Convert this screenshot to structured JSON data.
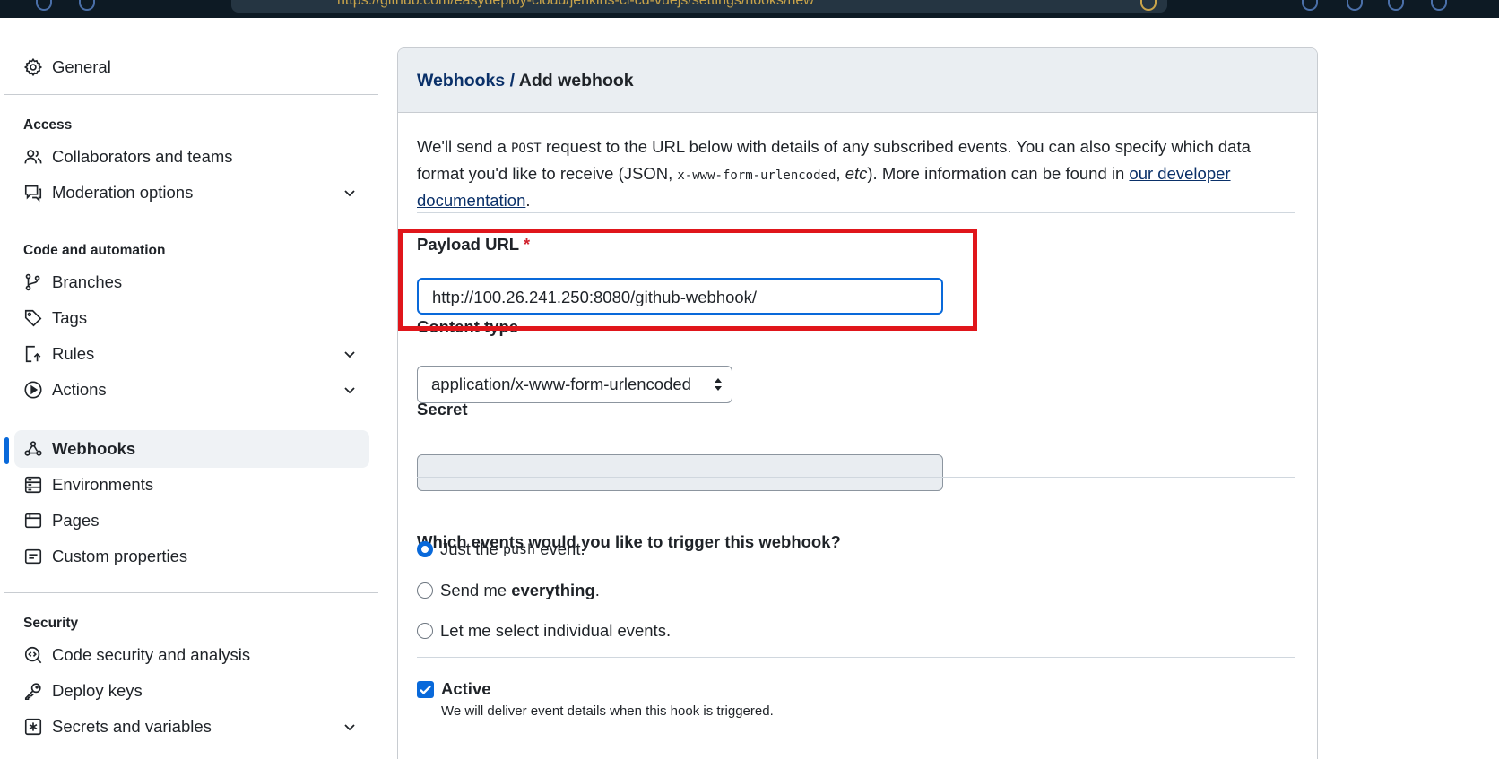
{
  "browser": {
    "url": "https://github.com/easydeploy-cloud/jenkins-ci-cd-vuejs/settings/hooks/new"
  },
  "sidebar": {
    "general": "General",
    "sections": {
      "access": "Access",
      "code_automation": "Code and automation",
      "security": "Security"
    },
    "items": {
      "collaborators": "Collaborators and teams",
      "moderation": "Moderation options",
      "branches": "Branches",
      "tags": "Tags",
      "rules": "Rules",
      "actions": "Actions",
      "webhooks": "Webhooks",
      "environments": "Environments",
      "pages": "Pages",
      "custom_properties": "Custom properties",
      "code_security": "Code security and analysis",
      "deploy_keys": "Deploy keys",
      "secrets": "Secrets and variables"
    }
  },
  "main": {
    "breadcrumb": {
      "parent": "Webhooks",
      "separator": "/",
      "current": "Add webhook"
    },
    "intro": {
      "part1": "We'll send a ",
      "code1": "POST",
      "part2": " request to the URL below with details of any subscribed events. You can also specify which data format you'd like to receive (JSON, ",
      "code2": "x-www-form-urlencoded",
      "part3": ", ",
      "etc": "etc",
      "part4": "). More information can be found in ",
      "link": "our developer documentation",
      "part5": "."
    },
    "payload_url": {
      "label": "Payload URL",
      "required_mark": "*",
      "value": "http://100.26.241.250:8080/github-webhook/"
    },
    "content_type": {
      "label": "Content type",
      "selected": "application/x-www-form-urlencoded"
    },
    "secret": {
      "label": "Secret",
      "value": ""
    },
    "events": {
      "question": "Which events would you like to trigger this webhook?",
      "option_push_pre": "Just the ",
      "option_push_code": "push",
      "option_push_post": " event.",
      "option_all_pre": "Send me ",
      "option_all_bold": "everything",
      "option_all_post": ".",
      "option_individual": "Let me select individual events.",
      "selected": "push"
    },
    "active": {
      "label": "Active",
      "checked": true,
      "help": "We will deliver event details when this hook is triggered."
    }
  },
  "colors": {
    "accent": "#0969da",
    "link": "#0a3069",
    "highlight_box": "#e0161b",
    "required": "#d1242f"
  }
}
